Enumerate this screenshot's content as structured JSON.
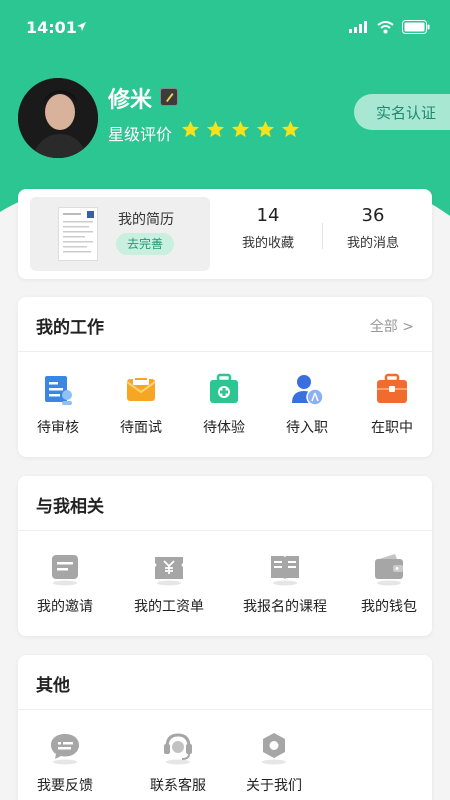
{
  "colors": {
    "brand": "#2cc692",
    "star": "#f5e21a"
  },
  "status_bar": {
    "time": "14:01",
    "icons": [
      "location-arrow-icon",
      "signal-icon",
      "wifi-icon",
      "battery-icon"
    ]
  },
  "profile": {
    "name": "修米",
    "rating_label": "星级评价",
    "stars": 5,
    "verify_label": "实名认证"
  },
  "summary": {
    "resume_title": "我的简历",
    "resume_action": "去完善",
    "favorites_count": "14",
    "favorites_label": "我的收藏",
    "messages_count": "36",
    "messages_label": "我的消息"
  },
  "my_work": {
    "title": "我的工作",
    "more": "全部 >",
    "items": [
      {
        "label": "待审核",
        "icon": "review-doc-icon"
      },
      {
        "label": "待面试",
        "icon": "interview-mail-icon"
      },
      {
        "label": "待体验",
        "icon": "medical-kit-icon"
      },
      {
        "label": "待入职",
        "icon": "user-join-icon"
      },
      {
        "label": "在职中",
        "icon": "briefcase-icon"
      }
    ]
  },
  "related": {
    "title": "与我相关",
    "items": [
      {
        "label": "我的邀请",
        "icon": "invitation-icon"
      },
      {
        "label": "我的工资单",
        "icon": "payslip-icon"
      },
      {
        "label": "我报名的课程",
        "icon": "course-book-icon"
      },
      {
        "label": "我的钱包",
        "icon": "wallet-icon"
      }
    ]
  },
  "other": {
    "title": "其他",
    "items": [
      {
        "label": "我要反馈",
        "icon": "feedback-icon"
      },
      {
        "label": "联系客服",
        "icon": "headset-icon"
      },
      {
        "label": "关于我们",
        "icon": "about-icon"
      }
    ]
  }
}
